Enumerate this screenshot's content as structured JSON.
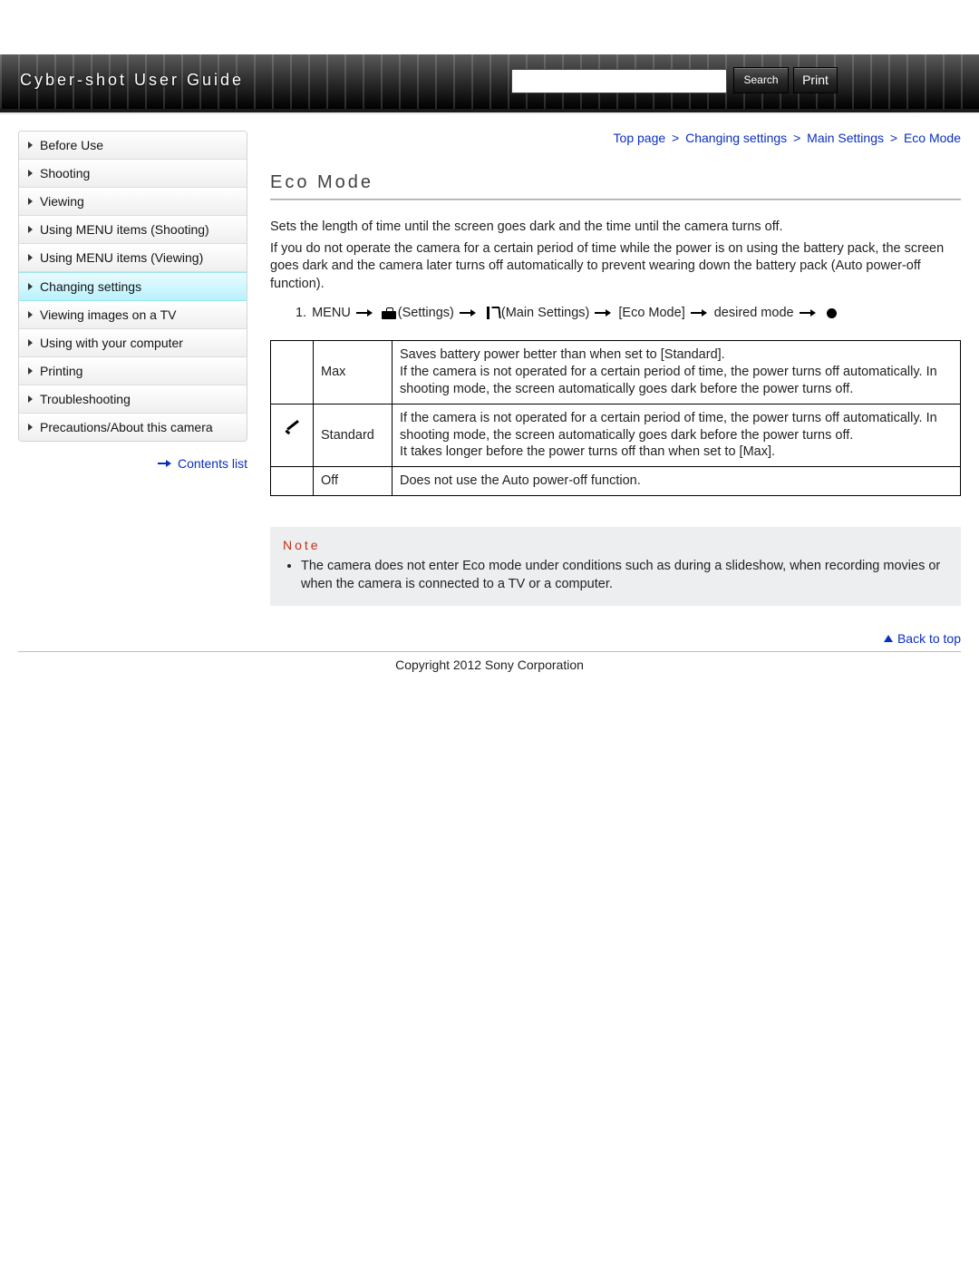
{
  "header": {
    "title": "Cyber-shot User Guide",
    "search_value": "",
    "search_button": "Search",
    "print_button": "Print"
  },
  "sidebar": {
    "items": [
      {
        "label": "Before Use"
      },
      {
        "label": "Shooting"
      },
      {
        "label": "Viewing"
      },
      {
        "label": "Using MENU items (Shooting)"
      },
      {
        "label": "Using MENU items (Viewing)"
      },
      {
        "label": "Changing settings",
        "active": true
      },
      {
        "label": "Viewing images on a TV"
      },
      {
        "label": "Using with your computer"
      },
      {
        "label": "Printing"
      },
      {
        "label": "Troubleshooting"
      },
      {
        "label": "Precautions/About this camera"
      }
    ],
    "contents_link": "Contents list"
  },
  "breadcrumb": {
    "items": [
      "Top page",
      "Changing settings",
      "Main Settings",
      "Eco Mode"
    ],
    "sep": ">"
  },
  "main": {
    "title": "Eco Mode",
    "para1": "Sets the length of time until the screen goes dark and the time until the camera turns off.",
    "para2": "If you do not operate the camera for a certain period of time while the power is on using the battery pack, the screen goes dark and the camera later turns off automatically to prevent wearing down the battery pack (Auto power-off function).",
    "step": {
      "num": "1.",
      "s0": "MENU",
      "s1": "(Settings)",
      "s2": "(Main Settings)",
      "s3": "[Eco Mode]",
      "s4": "desired mode"
    },
    "table": {
      "rows": [
        {
          "default": false,
          "name": "Max",
          "desc": "Saves battery power better than when set to [Standard].\nIf the camera is not operated for a certain period of time, the power turns off automatically. In shooting mode, the screen automatically goes dark before the power turns off."
        },
        {
          "default": true,
          "name": "Standard",
          "desc": "If the camera is not operated for a certain period of time, the power turns off automatically. In shooting mode, the screen automatically goes dark before the power turns off.\nIt takes longer before the power turns off than when set to [Max]."
        },
        {
          "default": false,
          "name": "Off",
          "desc": "Does not use the Auto power-off function."
        }
      ]
    },
    "note": {
      "title": "Note",
      "item": "The camera does not enter Eco mode under conditions such as during a slideshow, when recording movies or when the camera is connected to a TV or a computer."
    },
    "back_to_top": "Back to top"
  },
  "footer": {
    "copyright": "Copyright 2012 Sony Corporation"
  }
}
